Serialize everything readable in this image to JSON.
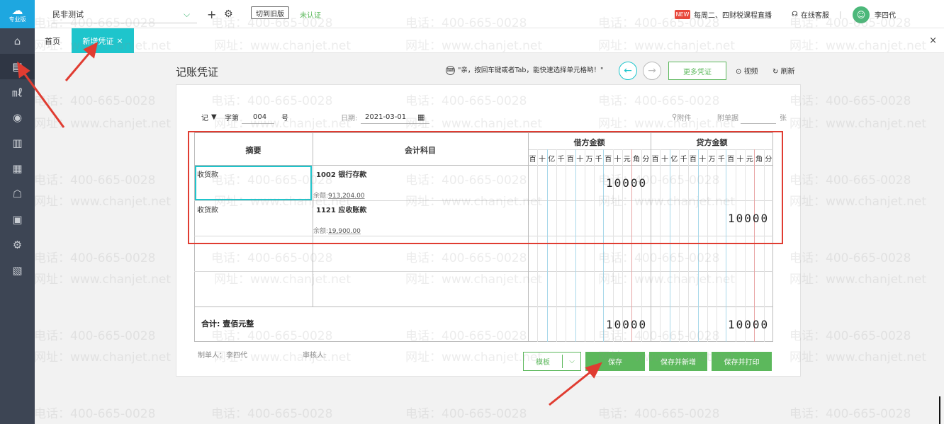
{
  "sidebar": {
    "logo_text": "专业版",
    "items": [
      {
        "name": "home-icon",
        "glyph": "⌂"
      },
      {
        "name": "voucher-icon",
        "glyph": "▤"
      },
      {
        "name": "report-chart-icon",
        "glyph": "㎖"
      },
      {
        "name": "money-bag-icon",
        "glyph": "◉"
      },
      {
        "name": "ledger-icon",
        "glyph": "▥"
      },
      {
        "name": "calculator-icon",
        "glyph": "▦"
      },
      {
        "name": "tax-icon",
        "glyph": "☖"
      },
      {
        "name": "invoice-icon",
        "glyph": "▣"
      },
      {
        "name": "settings-icon",
        "glyph": "⚙"
      },
      {
        "name": "calendar-icon",
        "glyph": "▧"
      }
    ]
  },
  "header": {
    "company": "民非测试",
    "switch_old": "切到旧版",
    "unauth": "未认证",
    "promo": "每周二、四财税课程直播",
    "promo_badge": "NEW",
    "service": "在线客服",
    "user_name": "李四代"
  },
  "tabs": {
    "home": "首页",
    "active": "新增凭证",
    "close": "×",
    "panel_close": "×"
  },
  "page": {
    "title": "记账凭证",
    "hint": "\"亲，按回车键或者Tab，能快速选择单元格哟！\"",
    "more": "更多凭证",
    "video": "视频",
    "refresh": "刷新"
  },
  "voucher": {
    "word": "记",
    "zidi": "字第",
    "number": "004",
    "hao": "号",
    "date_label": "日期:",
    "date": "2021-03-01",
    "attachment": "附件",
    "doc_count_label": "附单据",
    "zhang": "张"
  },
  "grid": {
    "col_summary": "摘要",
    "col_account": "会计科目",
    "col_debit": "借方金额",
    "col_credit": "贷方金额",
    "digits": [
      "百",
      "十",
      "亿",
      "千",
      "百",
      "十",
      "万",
      "千",
      "百",
      "十",
      "元",
      "角",
      "分"
    ],
    "rows": [
      {
        "summary": "收货款",
        "account": "1002 银行存款",
        "balance_label": "余额:",
        "balance": "913,204.00",
        "debit": "10000",
        "credit": ""
      },
      {
        "summary": "收货款",
        "account": "1121 应收账款",
        "balance_label": "余额:",
        "balance": "19,900.00",
        "debit": "",
        "credit": "10000"
      }
    ],
    "total_label": "合计:",
    "total_words": "壹佰元整",
    "total_debit": "10000",
    "total_credit": "10000"
  },
  "footer": {
    "maker": "制单人：李四代",
    "reviewer": "审核人:",
    "template": "模板",
    "template_arrow": "⌵",
    "save": "保存",
    "save_new": "保存并新增",
    "save_print": "保存并打印"
  },
  "watermark": {
    "phone": "电话：400-665-0028",
    "site": "网址：www.chanjet.net"
  },
  "colors": {
    "accent_teal": "#1ec5cc",
    "primary_green": "#5cb85c",
    "annotation_red": "#e03c31",
    "sidebar": "#3d4554"
  }
}
